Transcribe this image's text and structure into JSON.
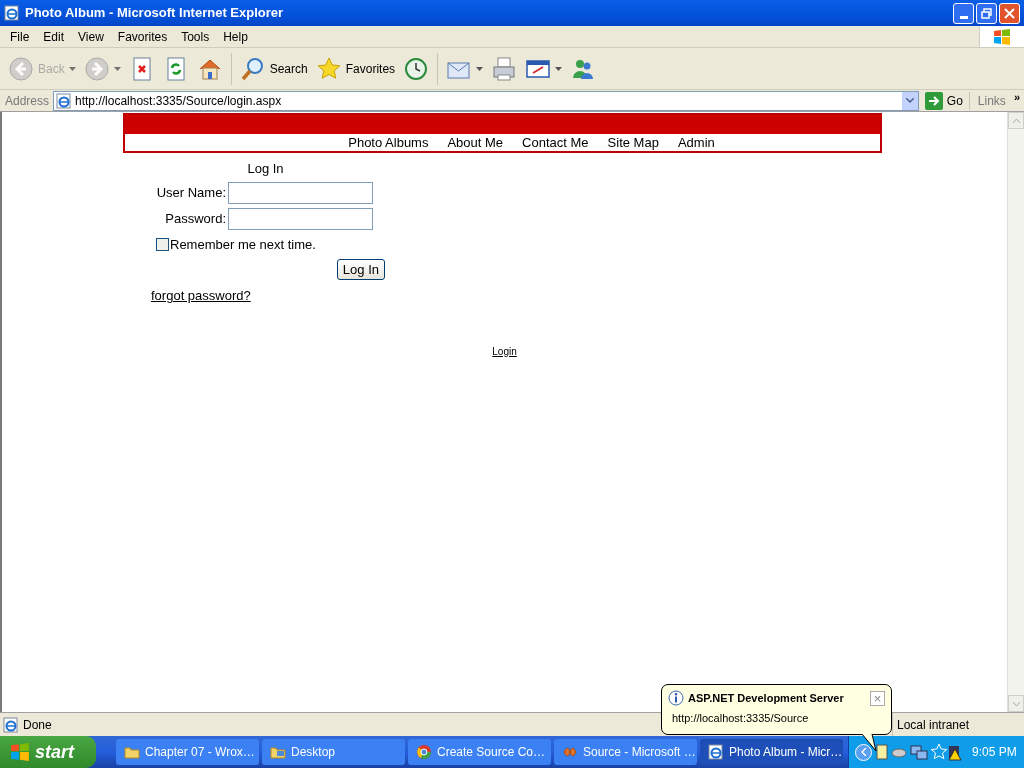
{
  "window": {
    "title": "Photo Album - Microsoft Internet Explorer"
  },
  "menu_bar": [
    "File",
    "Edit",
    "View",
    "Favorites",
    "Tools",
    "Help"
  ],
  "toolbar": [
    {
      "kind": "back",
      "label": "Back",
      "disabled": true,
      "dropdown": true
    },
    {
      "kind": "forward",
      "disabled": true,
      "dropdown": true
    },
    {
      "kind": "stop",
      "disabled": false,
      "dropdown": false
    },
    {
      "kind": "refresh",
      "disabled": false,
      "dropdown": false
    },
    {
      "kind": "home",
      "disabled": false,
      "dropdown": false
    },
    {
      "kind": "search",
      "label": "Search",
      "disabled": false,
      "dropdown": false
    },
    {
      "kind": "favorites",
      "label": "Favorites",
      "disabled": false,
      "dropdown": false
    },
    {
      "kind": "history",
      "disabled": false,
      "dropdown": false
    },
    {
      "kind": "mail",
      "disabled": false,
      "dropdown": true
    },
    {
      "kind": "print",
      "disabled": false,
      "dropdown": false
    },
    {
      "kind": "edit",
      "disabled": false,
      "dropdown": true
    },
    {
      "kind": "messenger",
      "disabled": false,
      "dropdown": false
    }
  ],
  "address_bar": {
    "label": "Address",
    "url": "http://localhost:3335/Source/login.aspx",
    "go": "Go",
    "links": "Links",
    "more": "»"
  },
  "page": {
    "nav": [
      "Photo Albums",
      "About Me",
      "Contact Me",
      "Site Map",
      "Admin"
    ],
    "login": {
      "title": "Log In",
      "fields": [
        {
          "label": "User Name:"
        },
        {
          "label": "Password:"
        }
      ],
      "remember": {
        "label": "Remember me next time.",
        "checked": false
      },
      "button": "Log In",
      "forgot": "forgot password?"
    },
    "footer_link": "Login"
  },
  "status_bar": {
    "text": "Done",
    "zone": "Local intranet"
  },
  "taskbar": {
    "start": "start",
    "tasks": [
      {
        "label": "Chapter 07 - Wrox…",
        "kind": "folder",
        "selected": false
      },
      {
        "label": "Desktop",
        "kind": "desktop",
        "selected": false
      },
      {
        "label": "Create Source Co…",
        "kind": "browser",
        "selected": false
      },
      {
        "label": "Source - Microsoft …",
        "kind": "studio",
        "selected": false
      },
      {
        "label": "Photo Album - Micr…",
        "kind": "ie",
        "selected": true
      }
    ],
    "clock": "9:05 PM"
  },
  "balloon": {
    "title": "ASP.NET Development Server",
    "text": "http://localhost:3335/Source",
    "close": "×"
  }
}
